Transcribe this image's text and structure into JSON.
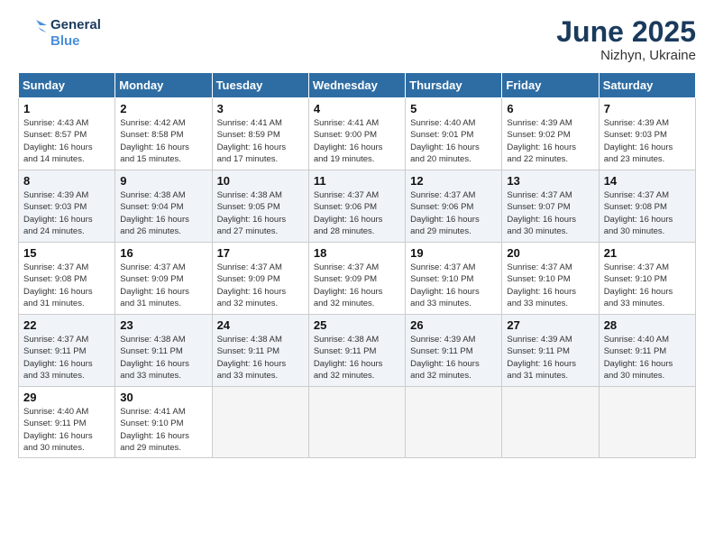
{
  "logo": {
    "line1": "General",
    "line2": "Blue"
  },
  "title": "June 2025",
  "subtitle": "Nizhyn, Ukraine",
  "days": [
    "Sunday",
    "Monday",
    "Tuesday",
    "Wednesday",
    "Thursday",
    "Friday",
    "Saturday"
  ],
  "weeks": [
    [
      {
        "day": "1",
        "sunrise": "4:43 AM",
        "sunset": "8:57 PM",
        "daylight": "16 hours and 14 minutes."
      },
      {
        "day": "2",
        "sunrise": "4:42 AM",
        "sunset": "8:58 PM",
        "daylight": "16 hours and 15 minutes."
      },
      {
        "day": "3",
        "sunrise": "4:41 AM",
        "sunset": "8:59 PM",
        "daylight": "16 hours and 17 minutes."
      },
      {
        "day": "4",
        "sunrise": "4:41 AM",
        "sunset": "9:00 PM",
        "daylight": "16 hours and 19 minutes."
      },
      {
        "day": "5",
        "sunrise": "4:40 AM",
        "sunset": "9:01 PM",
        "daylight": "16 hours and 20 minutes."
      },
      {
        "day": "6",
        "sunrise": "4:39 AM",
        "sunset": "9:02 PM",
        "daylight": "16 hours and 22 minutes."
      },
      {
        "day": "7",
        "sunrise": "4:39 AM",
        "sunset": "9:03 PM",
        "daylight": "16 hours and 23 minutes."
      }
    ],
    [
      {
        "day": "8",
        "sunrise": "4:39 AM",
        "sunset": "9:03 PM",
        "daylight": "16 hours and 24 minutes."
      },
      {
        "day": "9",
        "sunrise": "4:38 AM",
        "sunset": "9:04 PM",
        "daylight": "16 hours and 26 minutes."
      },
      {
        "day": "10",
        "sunrise": "4:38 AM",
        "sunset": "9:05 PM",
        "daylight": "16 hours and 27 minutes."
      },
      {
        "day": "11",
        "sunrise": "4:37 AM",
        "sunset": "9:06 PM",
        "daylight": "16 hours and 28 minutes."
      },
      {
        "day": "12",
        "sunrise": "4:37 AM",
        "sunset": "9:06 PM",
        "daylight": "16 hours and 29 minutes."
      },
      {
        "day": "13",
        "sunrise": "4:37 AM",
        "sunset": "9:07 PM",
        "daylight": "16 hours and 30 minutes."
      },
      {
        "day": "14",
        "sunrise": "4:37 AM",
        "sunset": "9:08 PM",
        "daylight": "16 hours and 30 minutes."
      }
    ],
    [
      {
        "day": "15",
        "sunrise": "4:37 AM",
        "sunset": "9:08 PM",
        "daylight": "16 hours and 31 minutes."
      },
      {
        "day": "16",
        "sunrise": "4:37 AM",
        "sunset": "9:09 PM",
        "daylight": "16 hours and 31 minutes."
      },
      {
        "day": "17",
        "sunrise": "4:37 AM",
        "sunset": "9:09 PM",
        "daylight": "16 hours and 32 minutes."
      },
      {
        "day": "18",
        "sunrise": "4:37 AM",
        "sunset": "9:09 PM",
        "daylight": "16 hours and 32 minutes."
      },
      {
        "day": "19",
        "sunrise": "4:37 AM",
        "sunset": "9:10 PM",
        "daylight": "16 hours and 33 minutes."
      },
      {
        "day": "20",
        "sunrise": "4:37 AM",
        "sunset": "9:10 PM",
        "daylight": "16 hours and 33 minutes."
      },
      {
        "day": "21",
        "sunrise": "4:37 AM",
        "sunset": "9:10 PM",
        "daylight": "16 hours and 33 minutes."
      }
    ],
    [
      {
        "day": "22",
        "sunrise": "4:37 AM",
        "sunset": "9:11 PM",
        "daylight": "16 hours and 33 minutes."
      },
      {
        "day": "23",
        "sunrise": "4:38 AM",
        "sunset": "9:11 PM",
        "daylight": "16 hours and 33 minutes."
      },
      {
        "day": "24",
        "sunrise": "4:38 AM",
        "sunset": "9:11 PM",
        "daylight": "16 hours and 33 minutes."
      },
      {
        "day": "25",
        "sunrise": "4:38 AM",
        "sunset": "9:11 PM",
        "daylight": "16 hours and 32 minutes."
      },
      {
        "day": "26",
        "sunrise": "4:39 AM",
        "sunset": "9:11 PM",
        "daylight": "16 hours and 32 minutes."
      },
      {
        "day": "27",
        "sunrise": "4:39 AM",
        "sunset": "9:11 PM",
        "daylight": "16 hours and 31 minutes."
      },
      {
        "day": "28",
        "sunrise": "4:40 AM",
        "sunset": "9:11 PM",
        "daylight": "16 hours and 30 minutes."
      }
    ],
    [
      {
        "day": "29",
        "sunrise": "4:40 AM",
        "sunset": "9:11 PM",
        "daylight": "16 hours and 30 minutes."
      },
      {
        "day": "30",
        "sunrise": "4:41 AM",
        "sunset": "9:10 PM",
        "daylight": "16 hours and 29 minutes."
      },
      null,
      null,
      null,
      null,
      null
    ]
  ],
  "labels": {
    "sunrise": "Sunrise:",
    "sunset": "Sunset:",
    "daylight": "Daylight:"
  }
}
